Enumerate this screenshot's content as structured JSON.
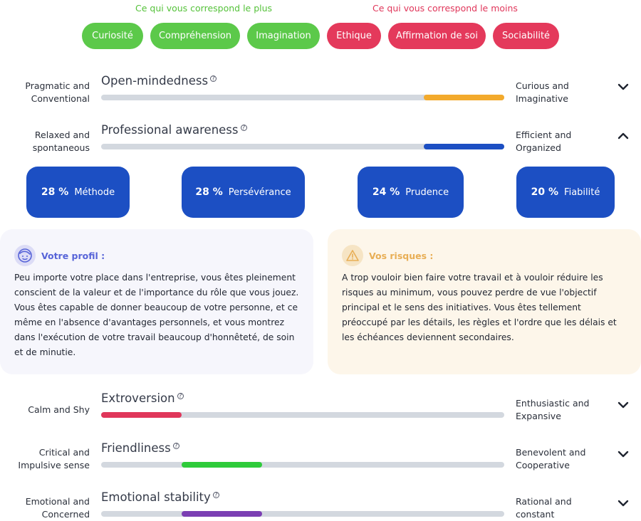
{
  "headers": {
    "plus": "Ce qui vous correspond le plus",
    "moins": "Ce qui vous correspond le moins"
  },
  "pills": [
    {
      "label": "Curiosité",
      "kind": "plus"
    },
    {
      "label": "Compréhension",
      "kind": "plus"
    },
    {
      "label": "Imagination",
      "kind": "plus"
    },
    {
      "label": "Ethique",
      "kind": "moins"
    },
    {
      "label": "Affirmation de soi",
      "kind": "moins"
    },
    {
      "label": "Sociabilité",
      "kind": "moins"
    }
  ],
  "traits": [
    {
      "left": "Pragmatic and Conventional",
      "name": "Open-mindedness",
      "right": "Curious and Imaginative",
      "bar_start": 0.8,
      "bar_end": 1.0,
      "color": "#f3aa2c",
      "expanded": false
    },
    {
      "left": "Relaxed and spontaneous",
      "name": "Professional awareness",
      "right": "Efficient and Organized",
      "bar_start": 0.8,
      "bar_end": 1.0,
      "color": "#1c4fc3",
      "expanded": true
    },
    {
      "left": "Calm and Shy",
      "name": "Extroversion",
      "right": "Enthusiastic and Expansive",
      "bar_start": 0.0,
      "bar_end": 0.2,
      "color": "#e0365a",
      "expanded": false
    },
    {
      "left": "Critical and Impulsive sense",
      "name": "Friendliness",
      "right": "Benevolent and Cooperative",
      "bar_start": 0.2,
      "bar_end": 0.4,
      "color": "#2ecb3a",
      "expanded": false
    },
    {
      "left": "Emotional and Concerned",
      "name": "Emotional stability",
      "right": "Rational and constant",
      "bar_start": 0.2,
      "bar_end": 0.4,
      "color": "#7b3fb3",
      "expanded": false
    }
  ],
  "facets": [
    {
      "pct": "28 %",
      "label": "Méthode"
    },
    {
      "pct": "28 %",
      "label": "Persévérance"
    },
    {
      "pct": "24 %",
      "label": "Prudence"
    },
    {
      "pct": "20 %",
      "label": "Fiabilité"
    }
  ],
  "profil": {
    "title": "Votre profil :",
    "icon": "face-icon",
    "text": "Peu importe votre place dans l'entreprise, vous êtes pleinement conscient de la valeur et de l'importance du rôle que vous jouez. Vous êtes capable de donner beaucoup de votre personne, et ce même en l'absence d'avantages personnels, et vous montrez dans l'exécution de votre travail beaucoup d'honnêteté, de soin et de minutie."
  },
  "risques": {
    "title": "Vos risques :",
    "icon": "warning-icon",
    "text": "A trop vouloir bien faire votre travail et à vouloir réduire les risques au minimum, vous pouvez perdre de vue l'objectif principal et le sens des initiatives. Vous êtes tellement préoccupé par les détails, les règles et l'ordre que les délais et les échéances deviennent secondaires."
  },
  "info_glyph": "?"
}
